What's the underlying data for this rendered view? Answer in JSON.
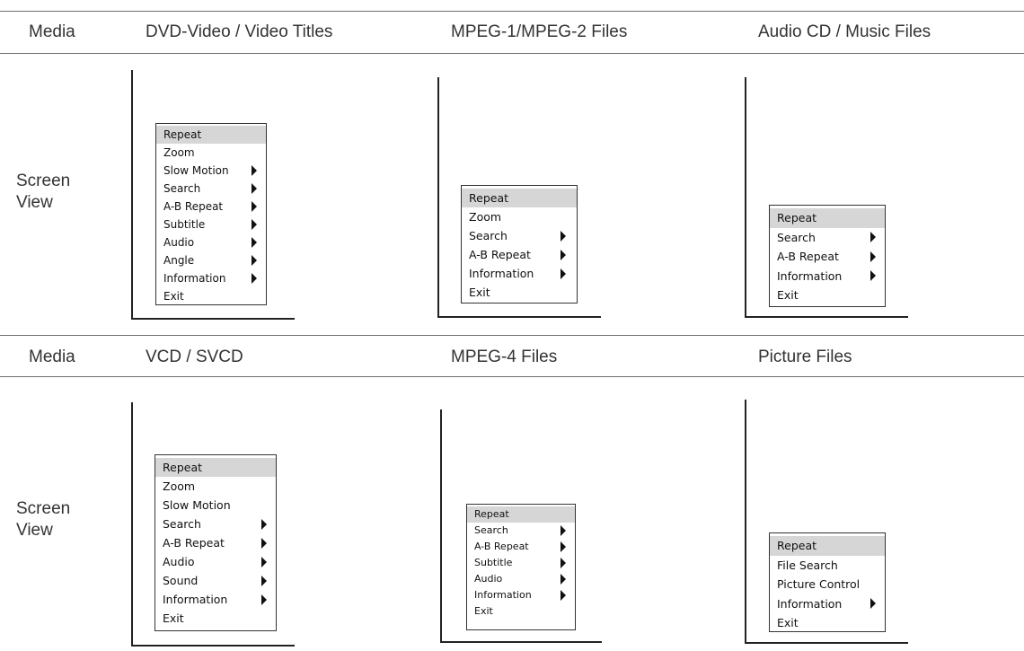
{
  "row1": {
    "media_label": "Media",
    "columns": [
      "DVD-Video / Video Titles",
      "MPEG-1/MPEG-2 Files",
      "Audio CD / Music Files"
    ],
    "screen_view_label": "Screen\nView",
    "menus": [
      {
        "items": [
          {
            "label": "Repeat",
            "submenu": false,
            "selected": true
          },
          {
            "label": "Zoom",
            "submenu": false
          },
          {
            "label": "Slow Motion",
            "submenu": true
          },
          {
            "label": "Search",
            "submenu": true
          },
          {
            "label": "A-B Repeat",
            "submenu": true
          },
          {
            "label": "Subtitle",
            "submenu": true
          },
          {
            "label": "Audio",
            "submenu": true
          },
          {
            "label": "Angle",
            "submenu": true
          },
          {
            "label": "Information",
            "submenu": true
          },
          {
            "label": "Exit",
            "submenu": false
          }
        ]
      },
      {
        "items": [
          {
            "label": "Repeat",
            "submenu": false,
            "selected": true
          },
          {
            "label": "Zoom",
            "submenu": false
          },
          {
            "label": "Search",
            "submenu": true
          },
          {
            "label": "A-B Repeat",
            "submenu": true
          },
          {
            "label": "Information",
            "submenu": true
          },
          {
            "label": "Exit",
            "submenu": false
          }
        ]
      },
      {
        "items": [
          {
            "label": "Repeat",
            "submenu": false,
            "selected": true
          },
          {
            "label": "Search",
            "submenu": true
          },
          {
            "label": "A-B Repeat",
            "submenu": true
          },
          {
            "label": "Information",
            "submenu": true
          },
          {
            "label": "Exit",
            "submenu": false
          }
        ]
      }
    ]
  },
  "row2": {
    "media_label": "Media",
    "columns": [
      "VCD / SVCD",
      "MPEG-4 Files",
      "Picture Files"
    ],
    "screen_view_label": "Screen\nView",
    "menus": [
      {
        "items": [
          {
            "label": "Repeat",
            "submenu": false,
            "selected": true
          },
          {
            "label": "Zoom",
            "submenu": false
          },
          {
            "label": "Slow Motion",
            "submenu": false
          },
          {
            "label": "Search",
            "submenu": true
          },
          {
            "label": "A-B Repeat",
            "submenu": true
          },
          {
            "label": "Audio",
            "submenu": true
          },
          {
            "label": "Sound",
            "submenu": true
          },
          {
            "label": "Information",
            "submenu": true
          },
          {
            "label": "Exit",
            "submenu": false
          }
        ]
      },
      {
        "items": [
          {
            "label": "Repeat",
            "submenu": false,
            "selected": true
          },
          {
            "label": "Search",
            "submenu": true
          },
          {
            "label": "A-B Repeat",
            "submenu": true
          },
          {
            "label": "Subtitle",
            "submenu": true
          },
          {
            "label": "Audio",
            "submenu": true
          },
          {
            "label": "Information",
            "submenu": true
          },
          {
            "label": "Exit",
            "submenu": false
          }
        ]
      },
      {
        "items": [
          {
            "label": "Repeat",
            "submenu": false,
            "selected": true
          },
          {
            "label": "File Search",
            "submenu": false
          },
          {
            "label": "Picture Control",
            "submenu": false
          },
          {
            "label": "Information",
            "submenu": true
          },
          {
            "label": "Exit",
            "submenu": false
          }
        ]
      }
    ]
  },
  "colors": {
    "rule": "#6e6e6e",
    "text": "#333333",
    "highlight": "#d6d6d6",
    "frame": "#222222"
  }
}
